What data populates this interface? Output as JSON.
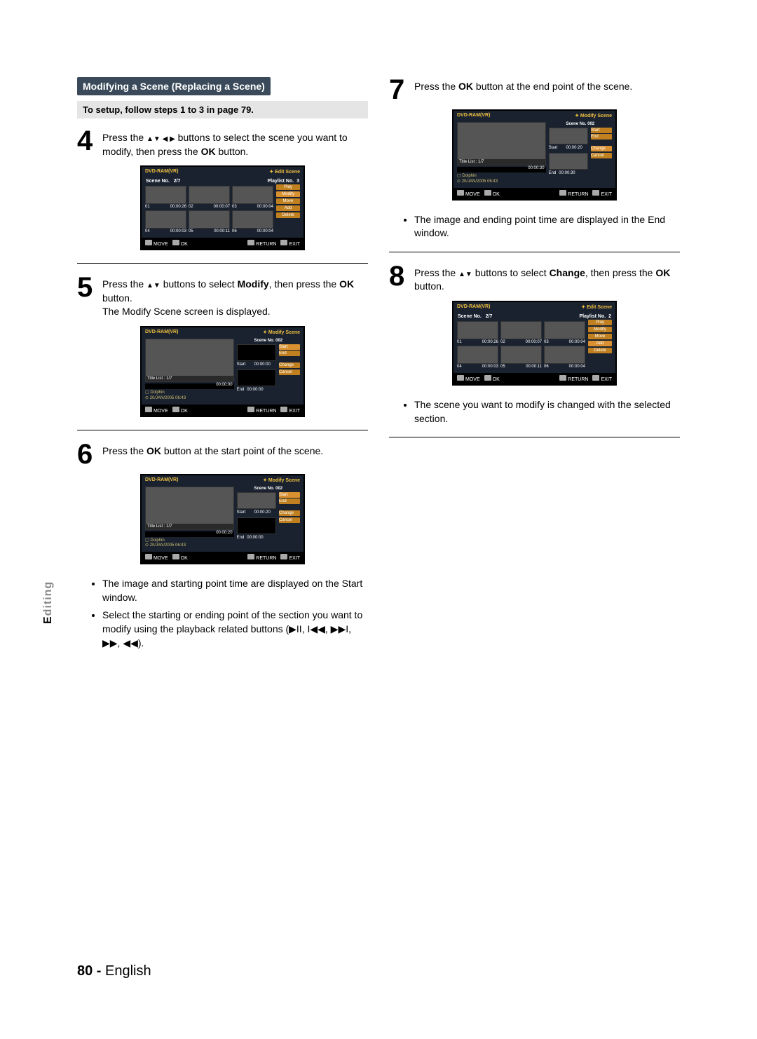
{
  "section_tab": "Editing",
  "header_title": "Modifying a Scene (Replacing a Scene)",
  "sub_header": "To setup, follow steps 1 to 3 in page 79.",
  "footer": {
    "page": "80 -",
    "lang": "English"
  },
  "steps": {
    "s4": {
      "n": "4",
      "text_a": "Press the ",
      "text_b": " buttons to select the scene you want to modify, then press the ",
      "ok": "OK",
      "text_c": " button."
    },
    "s5": {
      "n": "5",
      "text_a": "Press the ",
      "text_b": " buttons to select ",
      "bold": "Modify",
      "text_c": ", then press the ",
      "ok": "OK",
      "text_d": " button.",
      "line2": "The Modify Scene screen is displayed."
    },
    "s6": {
      "n": "6",
      "text_a": "Press the ",
      "ok": "OK",
      "text_b": " button at the start point of the scene."
    },
    "s6_bullets": [
      "The image and starting point time are displayed on the Start window.",
      "Select the starting or ending point of the section you want to modify using the playback related buttons (▶II, I◀◀, ▶▶I, ▶▶, ◀◀)."
    ],
    "s7": {
      "n": "7",
      "text_a": "Press the ",
      "ok": "OK",
      "text_b": " button at the end point of the scene."
    },
    "s7_bullets": [
      "The image and ending point time are displayed in the End window."
    ],
    "s8": {
      "n": "8",
      "text_a": "Press the ",
      "text_b": " buttons to select ",
      "bold": "Change",
      "text_c": ", then press the ",
      "ok": "OK",
      "text_d": " button."
    },
    "s8_bullets": [
      "The scene you want to modify is changed with the selected section."
    ]
  },
  "screens": {
    "edit": {
      "hdr_left": "DVD-RAM(VR)",
      "hdr_right": "Edit Scene",
      "scene_no": "Scene No.",
      "count": "2/7",
      "plno": "Playlist No.",
      "plval": "3",
      "plval2": "2",
      "cells": [
        {
          "n": "01",
          "t": "00:00:26"
        },
        {
          "n": "02",
          "t": "00:00:07"
        },
        {
          "n": "03",
          "t": "00:00:04"
        },
        {
          "n": "04",
          "t": "00:00:03"
        },
        {
          "n": "05",
          "t": "00:00:11"
        },
        {
          "n": "06",
          "t": "00:00:04"
        }
      ],
      "btns": [
        "Play",
        "Modify",
        "Move",
        "Add",
        "Delete"
      ]
    },
    "modify": {
      "hdr_left": "DVD-RAM(VR)",
      "hdr_right": "Modify Scene",
      "sceneno": "Scene No. 002",
      "title_list": "Title List : 1/7",
      "dolphin": "Dolphin",
      "date": "20/JAN/2005 06:43",
      "start": "Start",
      "end": "End",
      "change": "Change",
      "cancel": "Cancel",
      "t0": "00:00:00",
      "t20": "00:00:20",
      "t30": "00:00:30"
    },
    "helpbar": {
      "move": "MOVE",
      "ok": "OK",
      "return": "RETURN",
      "exit": "EXIT"
    }
  }
}
